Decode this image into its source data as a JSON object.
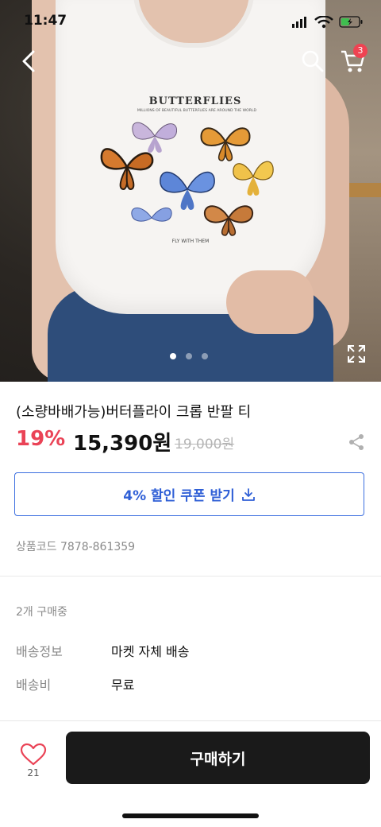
{
  "status": {
    "time": "11:47"
  },
  "header": {
    "cart_count": "3"
  },
  "hero": {
    "print_title": "BUTTERFLIES",
    "print_subtitle": "MILLIONS OF BEAUTIFUL BUTTERFLIES ARE AROUND THE WORLD",
    "print_bottom": "FLY WITH THEM",
    "image_count": 3,
    "active_index": 0
  },
  "product": {
    "title": "(소량바배가능)버터플라이 크롭 반팔 티",
    "discount": "19%",
    "price": "15,390원",
    "original_price": "19,000원",
    "coupon_label": "4% 할인 쿠폰 받기",
    "code": "상품코드 7878-861359"
  },
  "details": {
    "buyers": "2개 구매중",
    "rows": [
      {
        "label": "배송정보",
        "value": "마켓 자체 배송"
      },
      {
        "label": "배송비",
        "value": "무료"
      }
    ]
  },
  "bottom": {
    "like_count": "21",
    "buy_label": "구매하기"
  },
  "colors": {
    "accent_red": "#ea4356",
    "coupon_blue": "#2f5fd6",
    "buy_button": "#1a1a1a"
  },
  "icons": [
    "back-arrow-icon",
    "search-icon",
    "cart-icon",
    "expand-icon",
    "share-icon",
    "download-icon",
    "heart-icon",
    "signal-icon",
    "wifi-icon",
    "battery-icon"
  ]
}
